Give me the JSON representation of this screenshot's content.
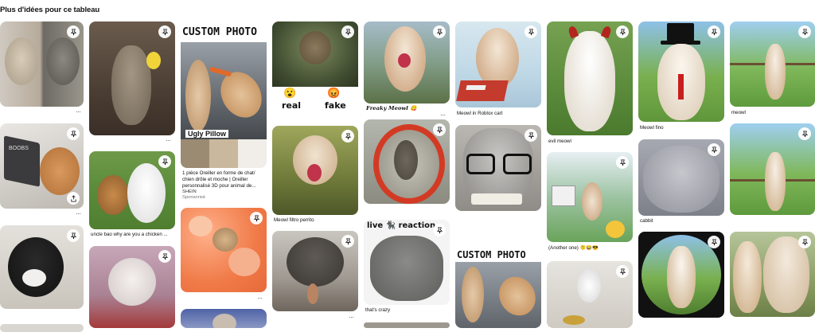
{
  "page": {
    "heading": "Plus d'idées pour ce tableau"
  },
  "pins": {
    "p1": {
      "caption": ""
    },
    "p2": {
      "caption": ""
    },
    "p3": {
      "caption": ""
    },
    "p4": {
      "caption": "uncle bao why are you a chicken ..."
    },
    "p5": {
      "caption": ""
    },
    "p6": {
      "caption": ""
    },
    "p7": {
      "overlay_top": "CUSTOM PHOTO",
      "overlay_bottom": "Ugly Pillow",
      "caption1": "1 pièce Oreiller en forme de chat/",
      "caption2": "chien drôle et moche | Oreiller",
      "caption3": "personnalisé 3D pour animal de...",
      "brand": "SHEIN",
      "sponsored": "Sponsorisé"
    },
    "p8": {
      "caption": ""
    },
    "p9": {
      "caption": ""
    },
    "p10": {
      "left_label": "real",
      "right_label": "fake",
      "left_emoji": "😮",
      "right_emoji": "😡"
    },
    "p11": {
      "caption": "Meowl filtro perrito"
    },
    "p12": {
      "caption": ""
    },
    "p13": {
      "overlay_bottom": "Freaky Meowl 😋"
    },
    "p14": {
      "caption": ""
    },
    "p15": {
      "overlay_top": "live 🐈‍⬛ reaction",
      "caption": "that's crazy"
    },
    "p16": {
      "caption": "Meowl in Roblox cart"
    },
    "p17": {
      "caption": ""
    },
    "p18": {
      "overlay_top": "CUSTOM PHOTO"
    },
    "p19": {
      "caption": "evil meowl"
    },
    "p20": {
      "caption": "(Another one) 🫠😂😎"
    },
    "p21": {
      "caption": ""
    },
    "p22": {
      "caption": "Meowl fino"
    },
    "p23": {
      "caption": "cabbit"
    },
    "p24": {
      "caption": ""
    },
    "p25": {
      "caption": "meowl"
    },
    "p26": {
      "caption": ""
    },
    "p27": {
      "caption": ""
    }
  },
  "icons": {
    "save": "pin-icon",
    "share": "share-icon",
    "more": "more-dots-icon"
  }
}
